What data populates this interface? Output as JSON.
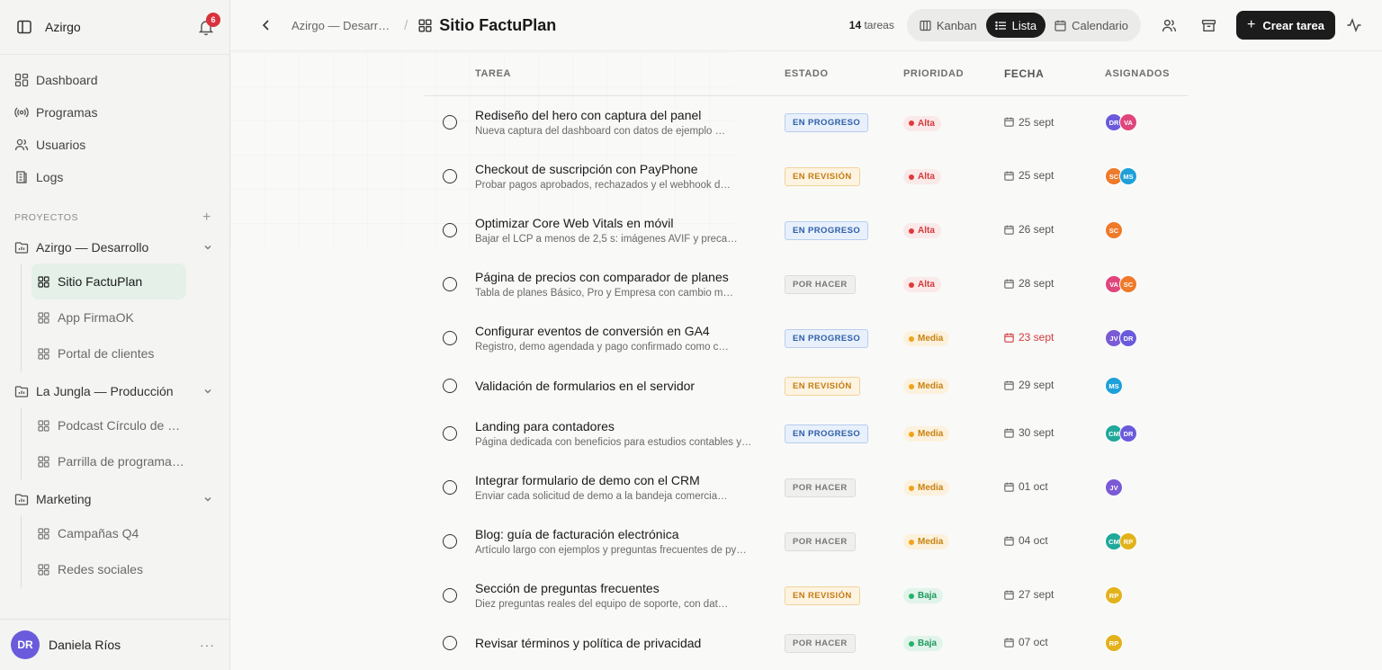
{
  "workspace": {
    "name": "Azirgo",
    "notifications": "6"
  },
  "nav": [
    {
      "label": "Dashboard",
      "icon": "dashboard-icon"
    },
    {
      "label": "Programas",
      "icon": "broadcast-icon"
    },
    {
      "label": "Usuarios",
      "icon": "users-icon"
    },
    {
      "label": "Logs",
      "icon": "logs-icon"
    }
  ],
  "projects_label": "PROYECTOS",
  "groups": [
    {
      "name": "Azirgo — Desarrollo",
      "children": [
        "Sitio FactuPlan",
        "App FirmaOK",
        "Portal de clientes"
      ]
    },
    {
      "name": "La Jungla — Producción",
      "children": [
        "Podcast Círculo de …",
        "Parrilla de programación"
      ]
    },
    {
      "name": "Marketing",
      "children": [
        "Campañas Q4",
        "Redes sociales"
      ]
    }
  ],
  "user": {
    "name": "Daniela Ríos",
    "initials": "DR"
  },
  "topbar": {
    "breadcrumb": "Azirgo — Desarr…",
    "title": "Sitio FactuPlan",
    "count_number": "14",
    "count_label": "tareas",
    "views": [
      "Kanban",
      "Lista",
      "Calendario"
    ],
    "active_view": "Lista",
    "create_label": "Crear tarea"
  },
  "columns": {
    "task": "TAREA",
    "state": "ESTADO",
    "priority": "PRIORIDAD",
    "date": "FECHA",
    "assigned": "ASIGNADOS"
  },
  "colors": {
    "progreso": "#2d5fa8",
    "revision": "#c47c12",
    "hacer": "#777777",
    "alta": "#d23b3b",
    "media": "#c88312",
    "baja": "#1f9a5e"
  },
  "tasks": [
    {
      "title": "Rediseño del hero con captura del panel",
      "desc": "Nueva captura del dashboard con datos de ejemplo …",
      "status": "EN PROGRESO",
      "priority": "Alta",
      "date": "25 sept",
      "assignees": [
        "DR",
        "VA"
      ]
    },
    {
      "title": "Checkout de suscripción con PayPhone",
      "desc": "Probar pagos aprobados, rechazados y el webhook d…",
      "status": "EN REVISIÓN",
      "priority": "Alta",
      "date": "25 sept",
      "assignees": [
        "SC",
        "MS"
      ]
    },
    {
      "title": "Optimizar Core Web Vitals en móvil",
      "desc": "Bajar el LCP a menos de 2,5 s: imágenes AVIF y preca…",
      "status": "EN PROGRESO",
      "priority": "Alta",
      "date": "26 sept",
      "assignees": [
        "SC"
      ]
    },
    {
      "title": "Página de precios con comparador de planes",
      "desc": "Tabla de planes Básico, Pro y Empresa con cambio m…",
      "status": "POR HACER",
      "priority": "Alta",
      "date": "28 sept",
      "assignees": [
        "VA",
        "SC"
      ]
    },
    {
      "title": "Configurar eventos de conversión en GA4",
      "desc": "Registro, demo agendada y pago confirmado como c…",
      "status": "EN PROGRESO",
      "priority": "Media",
      "date": "23 sept",
      "overdue": true,
      "assignees": [
        "JV",
        "DR"
      ]
    },
    {
      "title": "Validación de formularios en el servidor",
      "desc": "",
      "status": "EN REVISIÓN",
      "priority": "Media",
      "date": "29 sept",
      "assignees": [
        "MS"
      ]
    },
    {
      "title": "Landing para contadores",
      "desc": "Página dedicada con beneficios para estudios contables y…",
      "status": "EN PROGRESO",
      "priority": "Media",
      "date": "30 sept",
      "assignees": [
        "CM",
        "DR"
      ]
    },
    {
      "title": "Integrar formulario de demo con el CRM",
      "desc": "Enviar cada solicitud de demo a la bandeja comercia…",
      "status": "POR HACER",
      "priority": "Media",
      "date": "01 oct",
      "assignees": [
        "JV"
      ]
    },
    {
      "title": "Blog: guía de facturación electrónica",
      "desc": "Artículo largo con ejemplos y preguntas frecuentes de py…",
      "status": "POR HACER",
      "priority": "Media",
      "date": "04 oct",
      "assignees": [
        "CM",
        "RP"
      ]
    },
    {
      "title": "Sección de preguntas frecuentes",
      "desc": "Diez preguntas reales del equipo de soporte, con dat…",
      "status": "EN REVISIÓN",
      "priority": "Baja",
      "date": "27 sept",
      "assignees": [
        "RP"
      ]
    },
    {
      "title": "Revisar términos y política de privacidad",
      "desc": "",
      "status": "POR HACER",
      "priority": "Baja",
      "date": "07 oct",
      "assignees": [
        "RP"
      ]
    }
  ],
  "avatar_colors": {
    "DR": "#6a5bdc",
    "VA": "#e0457b",
    "SC": "#ee7a2a",
    "MS": "#1ea0d8",
    "JV": "#7b5ad6",
    "CM": "#20a89a",
    "RP": "#e3b21b"
  }
}
